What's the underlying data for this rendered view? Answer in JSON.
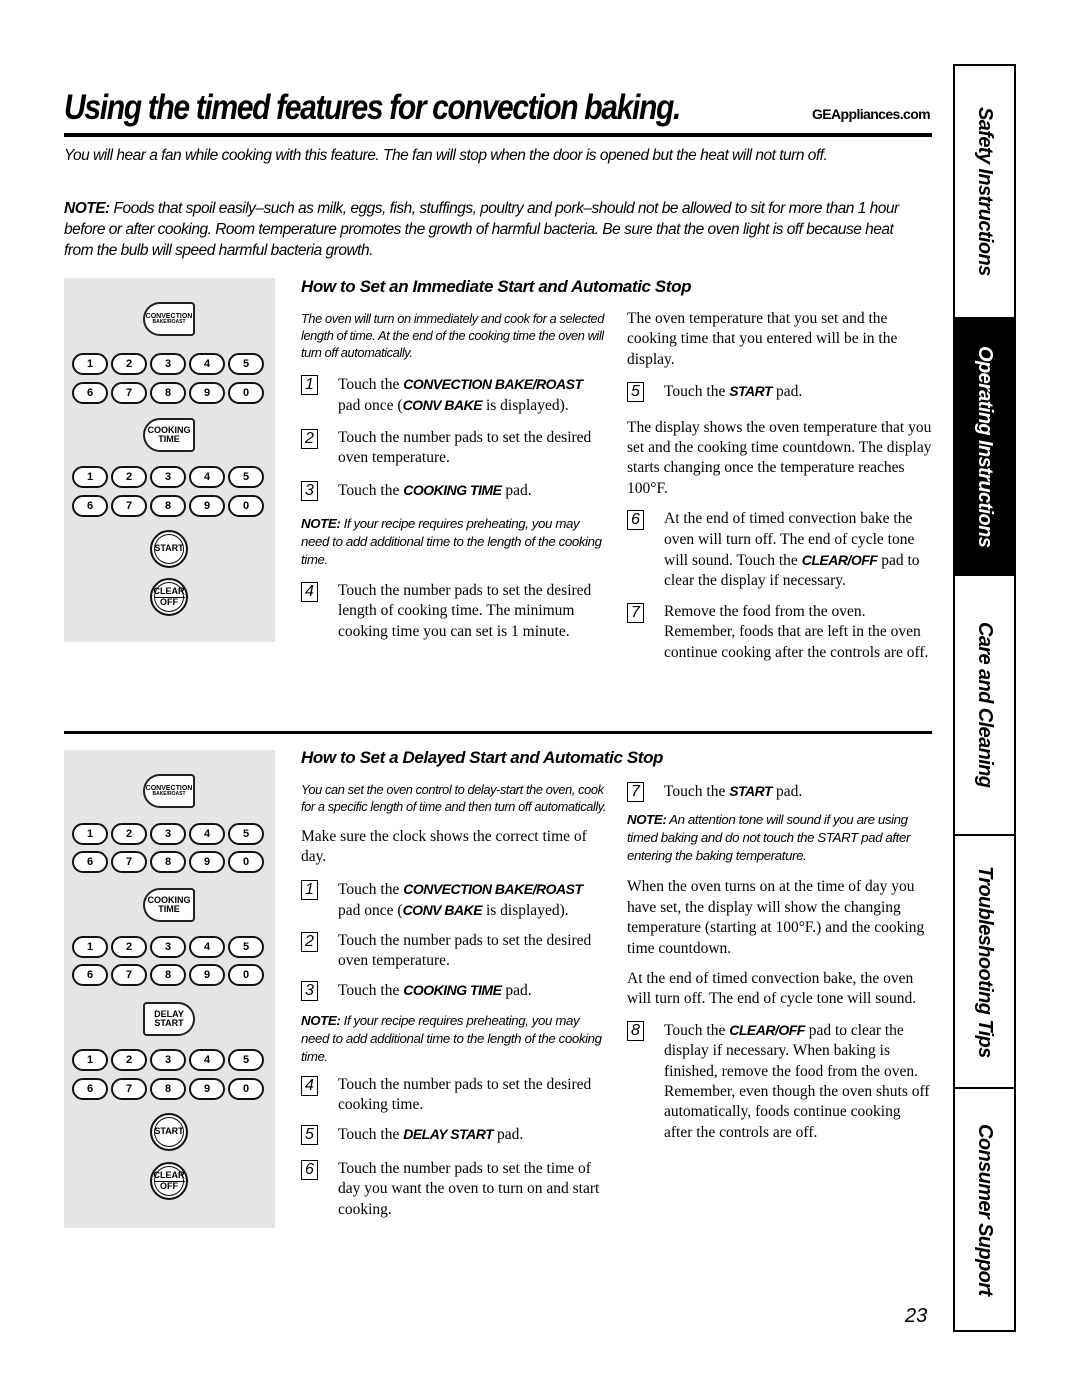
{
  "header": {
    "title": "Using the timed features for convection baking.",
    "site": "GEAppliances.com"
  },
  "intro": {
    "fan_text": "You will hear a fan while cooking with this feature. The fan will stop when the door is opened but the heat will not turn off.",
    "note_label": "NOTE:",
    "note_text": " Foods that spoil easily–such as milk, eggs, fish, stuffings, poultry and pork–should not be allowed to sit for more than 1 hour before or after cooking. Room temperature promotes the growth of harmful bacteria. Be sure that the oven light is off because heat from the bulb will speed harmful bacteria growth."
  },
  "keypad": {
    "convection_line1": "CONVECTION",
    "convection_line2": "BAKE/ROAST",
    "cooking_line1": "COOKING",
    "cooking_line2": "TIME",
    "delay_line1": "DELAY",
    "delay_line2": "START",
    "numbers_row1": [
      "1",
      "2",
      "3",
      "4",
      "5"
    ],
    "numbers_row2": [
      "6",
      "7",
      "8",
      "9",
      "0"
    ],
    "start": "START",
    "clear_line1": "CLEAR",
    "clear_line2": "OFF"
  },
  "immediate": {
    "heading": "How to Set an Immediate Start and Automatic Stop",
    "intro": "The oven will turn on immediately and cook for a selected length of time. At the end of the cooking time the oven will turn off automatically.",
    "step1": {
      "num": "1",
      "pre": "Touch the ",
      "kw": "CONVECTION BAKE/ROAST",
      "mid": " pad once (",
      "kw2": "CONV BAKE",
      "post": " is displayed)."
    },
    "step2": {
      "num": "2",
      "text": "Touch the number pads to set the desired oven temperature."
    },
    "step3": {
      "num": "3",
      "pre": "Touch the ",
      "kw": "COOKING TIME",
      "post": " pad."
    },
    "note_label": "NOTE:",
    "note_text": " If your recipe requires preheating, you may need to add additional time to the length of the cooking time.",
    "step4": {
      "num": "4",
      "text": "Touch the number pads to set the desired length of cooking time. The minimum cooking time you can set is 1 minute."
    },
    "display_text": "The oven temperature that you set and the cooking time that you entered will be in the display.",
    "step5": {
      "num": "5",
      "pre": "Touch the ",
      "kw": "START",
      "post": " pad."
    },
    "countdown_text": "The display shows the oven temperature that you set and the cooking time countdown. The display starts changing once the temperature reaches 100°F.",
    "step6": {
      "num": "6",
      "pre": "At the end of timed convection bake the oven will turn off. The end of cycle tone will sound. Touch the ",
      "kw": "CLEAR/OFF",
      "post": " pad to clear the display if necessary."
    },
    "step7": {
      "num": "7",
      "text": "Remove the food from the oven. Remember, foods that are left in the oven continue cooking after the controls are off."
    }
  },
  "delayed": {
    "heading": "How to Set a Delayed Start and Automatic Stop",
    "intro": "You can set the oven control to delay-start the oven, cook for a specific length of time and then turn off automatically.",
    "clock_text": "Make sure the clock shows the correct time of day.",
    "step1": {
      "num": "1",
      "pre": "Touch the ",
      "kw": "CONVECTION BAKE/ROAST",
      "mid": " pad once (",
      "kw2": "CONV BAKE",
      "post": " is displayed)."
    },
    "step2": {
      "num": "2",
      "text": "Touch the number pads to set the desired oven temperature."
    },
    "step3": {
      "num": "3",
      "pre": "Touch the ",
      "kw": "COOKING TIME",
      "post": " pad."
    },
    "note_label": "NOTE:",
    "note_text": " If your recipe requires preheating, you may need to add additional time to the length of the cooking time.",
    "step4": {
      "num": "4",
      "text": "Touch the number pads to set the desired cooking time."
    },
    "step5": {
      "num": "5",
      "pre": "Touch the ",
      "kw": "DELAY START",
      "post": " pad."
    },
    "step6": {
      "num": "6",
      "text": "Touch the number pads to set the time of day you want the oven to turn on and start cooking."
    },
    "step7": {
      "num": "7",
      "pre": "Touch the ",
      "kw": "START",
      "post": " pad."
    },
    "note2_label": "NOTE:",
    "note2_text": " An attention tone will sound if you are using timed baking and do not touch the START pad after entering the baking temperature.",
    "turns_on_text": "When the oven turns on at the time of day you have set, the display will show the changing temperature (starting at 100°F.) and the cooking time countdown.",
    "end_text": "At the end of timed convection bake, the oven will turn off. The end of cycle tone will sound.",
    "step8": {
      "num": "8",
      "pre": "Touch the ",
      "kw": "CLEAR/OFF",
      "post": " pad to clear the display if necessary. When baking is finished, remove the food from the oven. Remember, even though the oven shuts off automatically, foods continue cooking after the controls are off."
    }
  },
  "side_tabs": [
    {
      "label": "Safety Instructions",
      "active": false
    },
    {
      "label": "Operating Instructions",
      "active": true
    },
    {
      "label": "Care and Cleaning",
      "active": false
    },
    {
      "label": "Troubleshooting Tips",
      "active": false
    },
    {
      "label": "Consumer Support",
      "active": false
    }
  ],
  "page_number": "23"
}
